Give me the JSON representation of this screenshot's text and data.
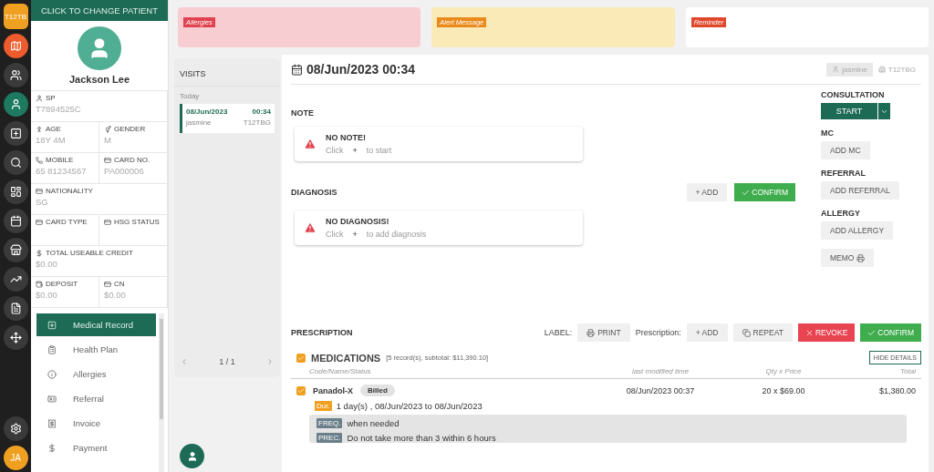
{
  "rail": {
    "badge": "T12TB",
    "items": [
      {
        "kind": "map",
        "selected": false
      },
      {
        "kind": "users",
        "selected": false
      },
      {
        "kind": "user",
        "selected": true
      },
      {
        "kind": "plus",
        "selected": false
      },
      {
        "kind": "search",
        "selected": false
      },
      {
        "kind": "dashboard",
        "selected": false
      },
      {
        "kind": "calendar",
        "selected": false
      },
      {
        "kind": "store",
        "selected": false
      },
      {
        "kind": "chart",
        "selected": false
      },
      {
        "kind": "list",
        "selected": false
      },
      {
        "kind": "move",
        "selected": false
      }
    ],
    "avatar": "JA"
  },
  "patient": {
    "change_button": "CLICK TO CHANGE PATIENT",
    "name": "Jackson Lee",
    "fields": [
      {
        "label": "SP",
        "value": "T7894525C",
        "wide": true
      },
      {
        "label": "AGE",
        "value": "18Y 4M",
        "wide": false
      },
      {
        "label": "GENDER",
        "value": "M",
        "wide": false
      },
      {
        "label": "MOBILE",
        "value": "65 81234567",
        "wide": false
      },
      {
        "label": "CARD NO.",
        "value": "PA000006",
        "wide": false
      },
      {
        "label": "NATIONALITY",
        "value": "SG",
        "wide": true
      },
      {
        "label": "CARD TYPE",
        "wide": false
      },
      {
        "label": "HSG STATUS",
        "wide": false
      },
      {
        "label": "TOTAL USEABLE CREDIT",
        "value": "$0.00",
        "wide": true
      },
      {
        "label": "DEPOSIT",
        "value": "$0.00",
        "wide": false
      },
      {
        "label": "CN",
        "value": "$0.00",
        "wide": false
      }
    ]
  },
  "menu": [
    {
      "label": "Medical Record",
      "selected": true
    },
    {
      "label": "Health Plan",
      "selected": false
    },
    {
      "label": "Allergies",
      "selected": false
    },
    {
      "label": "Referral",
      "selected": false
    },
    {
      "label": "Invoice",
      "selected": false
    },
    {
      "label": "Payment",
      "selected": false
    }
  ],
  "alerts": [
    {
      "label": "Allergies",
      "kind": "allergy"
    },
    {
      "label": "Alert Message",
      "kind": "alert"
    },
    {
      "label": "Reminder",
      "kind": "reminder"
    }
  ],
  "visits": {
    "title": "VISITS",
    "group": "Today",
    "items": [
      {
        "date": "08/Jun/2023",
        "time": "00:34",
        "user": "jasmine",
        "terminal": "T12TBG",
        "selected": true
      }
    ],
    "pager": "1 / 1"
  },
  "visit": {
    "date": "08/Jun/2023 00:34",
    "user": "jasmine",
    "terminal": "T12TBG"
  },
  "note": {
    "title": "NOTE",
    "empty_title": "NO NOTE!",
    "click": "Click",
    "plus": "+",
    "hint": "to start"
  },
  "diagnosis": {
    "title": "DIAGNOSIS",
    "add": "+ ADD",
    "confirm": "CONFIRM",
    "empty_title": "NO DIAGNOSIS!",
    "click": "Click",
    "plus": "+",
    "hint": "to add diagnosis"
  },
  "side": [
    {
      "title": "CONSULTATION",
      "button": "START",
      "kind": "split"
    },
    {
      "title": "MC",
      "button": "ADD MC",
      "kind": "plain"
    },
    {
      "title": "REFERRAL",
      "button": "ADD REFERRAL",
      "kind": "plain"
    },
    {
      "title": "ALLERGY",
      "button": "ADD ALLERGY",
      "kind": "plain"
    },
    {
      "button": "MEMO",
      "kind": "print"
    }
  ],
  "prescription": {
    "title": "PRESCRIPTION",
    "label_caption": "LABEL:",
    "print": "PRINT",
    "prescription_caption": "Prescription:",
    "add": "+ ADD",
    "repeat": "REPEAT",
    "revoke": "REVOKE",
    "confirm": "CONFIRM"
  },
  "medications": {
    "checked": true,
    "title": "MEDICATIONS",
    "summary": "[5 record(s), subtotal: $11,390.10]",
    "hide_details": "HIDE DETAILS",
    "columns": [
      "Code/Name/Status",
      "last modified time",
      "Qty x Price",
      "Total"
    ],
    "rows": [
      {
        "checked": true,
        "name": "Panadol-X",
        "status": "Billed",
        "modified": "08/Jun/2023 00:37",
        "qty_price": "20 x $69.00",
        "total": "$1,380.00",
        "duration_tag": "Dur.",
        "duration": "1 day(s) , 08/Jun/2023 to 08/Jun/2023",
        "details": [
          {
            "tag": "FREQ.",
            "text": "when needed"
          },
          {
            "tag": "PREC.",
            "text": "Do not take more than 3 within 6 hours"
          }
        ]
      }
    ]
  }
}
